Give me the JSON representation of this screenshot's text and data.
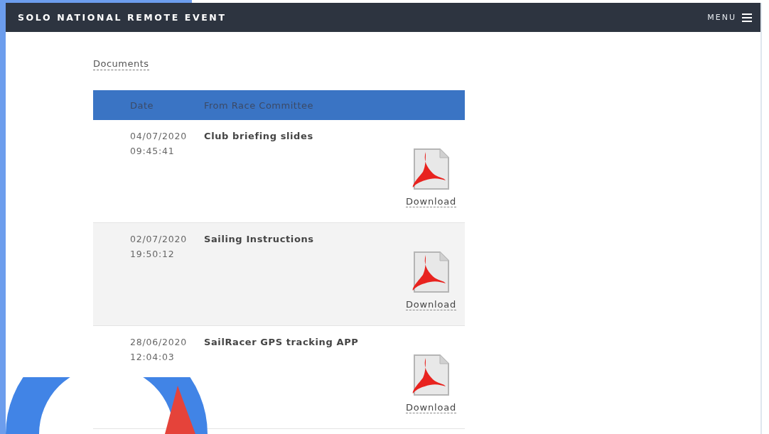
{
  "header": {
    "title": "SOLO NATIONAL REMOTE EVENT",
    "menu": "MENU"
  },
  "breadcrumb": "Documents",
  "table": {
    "columns": [
      "Date",
      "From Race Committee"
    ],
    "rows": [
      {
        "date": "04/07/2020",
        "time": "09:45:41",
        "title": "Club briefing slides",
        "link": "Download"
      },
      {
        "date": "02/07/2020",
        "time": "19:50:12",
        "title": "Sailing Instructions",
        "link": "Download"
      },
      {
        "date": "28/06/2020",
        "time": "12:04:03",
        "title": "SailRacer GPS tracking APP",
        "link": "Download"
      }
    ]
  }
}
